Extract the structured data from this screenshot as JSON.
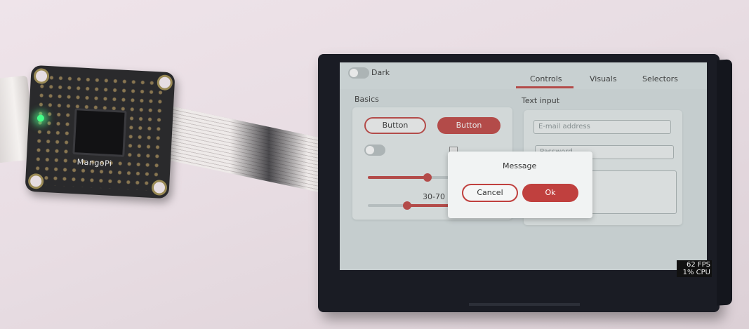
{
  "board": {
    "label": "MangoPi"
  },
  "header": {
    "dark_toggle_label": "Dark",
    "tabs": [
      {
        "label": "Controls",
        "active": true
      },
      {
        "label": "Visuals",
        "active": false
      },
      {
        "label": "Selectors",
        "active": false
      }
    ]
  },
  "basics": {
    "title": "Basics",
    "button_outline_label": "Button",
    "button_fill_label": "Button",
    "slider_value": 0.45,
    "range_slider_label": "30-70",
    "range_min": 30,
    "range_max": 70
  },
  "text_input": {
    "title": "Text input",
    "email_placeholder": "E-mail address",
    "password_placeholder": "Password"
  },
  "message_box": {
    "title": "Message",
    "cancel_label": "Cancel",
    "ok_label": "Ok"
  },
  "perf": {
    "fps": "62 FPS",
    "cpu": "1% CPU"
  },
  "colors": {
    "accent": "#c0403e",
    "screen_bg": "#d6dfe0",
    "bezel": "#1a1c24"
  }
}
